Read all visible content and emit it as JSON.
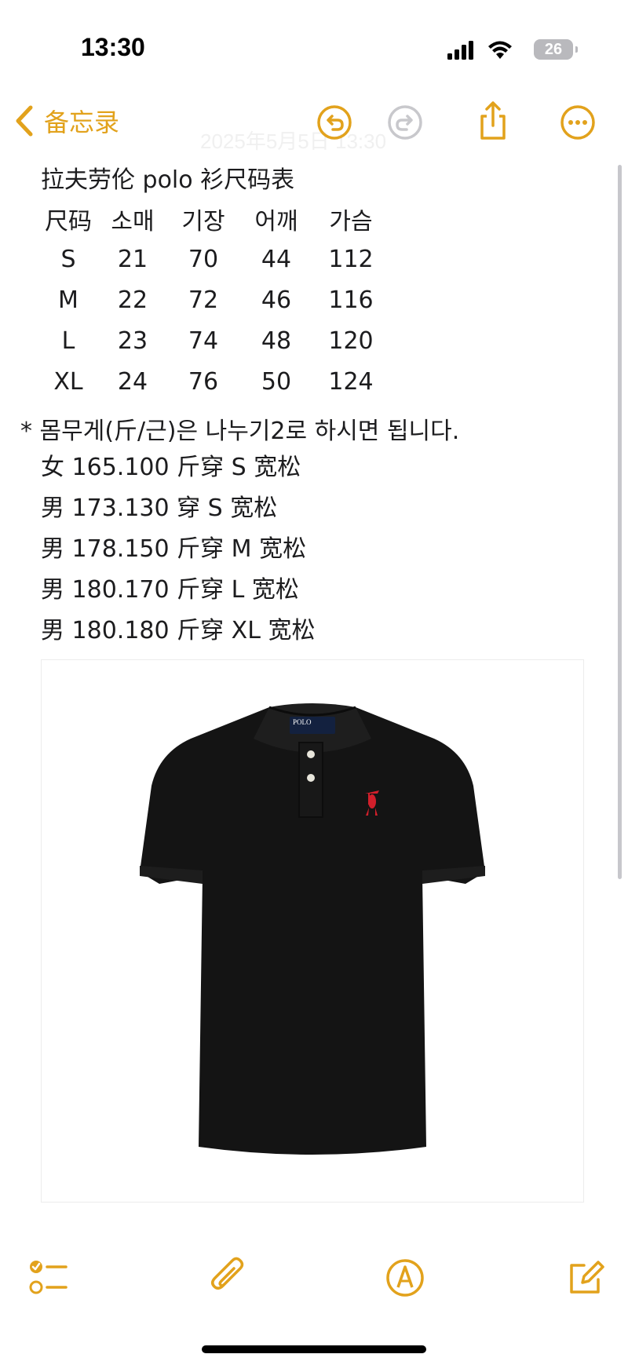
{
  "status_bar": {
    "time": "13:30",
    "battery": "26"
  },
  "nav": {
    "back_label": "备忘录",
    "ghost_date": "2025年5月5日 13:30"
  },
  "note": {
    "title": "拉夫劳伦 polo 衫尺码表",
    "table": {
      "headers": [
        "尺码",
        "소매",
        "기장",
        "어깨",
        "가슴"
      ],
      "rows": [
        [
          "S",
          "21",
          "70",
          "44",
          "112"
        ],
        [
          "M",
          "22",
          "72",
          "46",
          "116"
        ],
        [
          "L",
          "23",
          "74",
          "48",
          "120"
        ],
        [
          "XL",
          "24",
          "76",
          "50",
          "124"
        ]
      ]
    },
    "remark": "* 몸무게(斤/근)은 나누기2로 하시면 됩니다.",
    "fit_lines": [
      "女 165.100 斤穿 S 宽松",
      "男 173.130 穿 S 宽松",
      "男 178.150 斤穿 M 宽松",
      "男 180.170 斤穿 L 宽松",
      "男 180.180 斤穿 XL 宽松"
    ],
    "image": {
      "logo_text": "POLO"
    }
  },
  "colors": {
    "accent": "#e2a21c",
    "shirt": "#141414",
    "pony": "#d21f2b"
  },
  "icons": [
    "chevron-left-icon",
    "undo-icon",
    "redo-icon",
    "share-icon",
    "more-icon",
    "checklist-icon",
    "paperclip-icon",
    "markup-icon",
    "compose-icon"
  ]
}
